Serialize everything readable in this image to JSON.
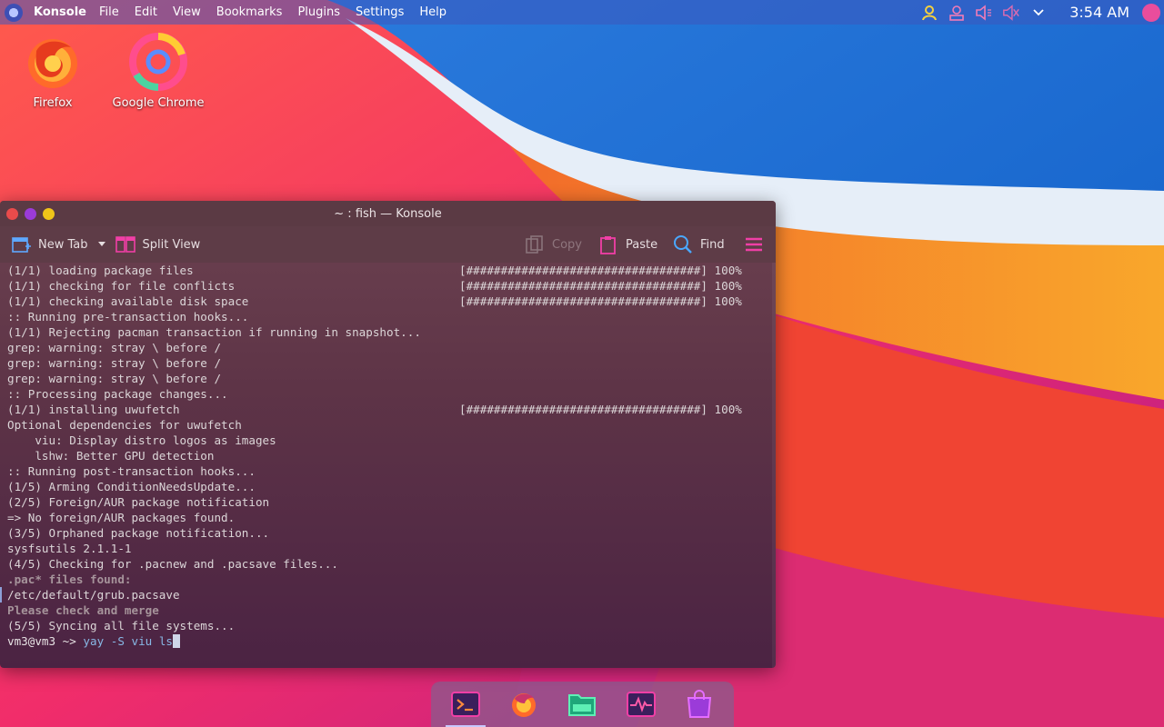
{
  "top_panel": {
    "app_name": "Konsole",
    "menu": [
      "File",
      "Edit",
      "View",
      "Bookmarks",
      "Plugins",
      "Settings",
      "Help"
    ],
    "clock": "3:54 AM",
    "tray_icons": [
      "user-icon",
      "account-icon",
      "volume-icon",
      "speaker-muted-icon",
      "chevron-down-icon"
    ]
  },
  "desktop": {
    "icons": [
      {
        "label": "Firefox",
        "icon": "firefox-icon"
      },
      {
        "label": "Google Chrome",
        "icon": "chrome-icon"
      }
    ]
  },
  "window": {
    "title": "~ : fish — Konsole",
    "toolbar": {
      "new_tab": "New Tab",
      "split_view": "Split View",
      "copy": "Copy",
      "paste": "Paste",
      "find": "Find"
    }
  },
  "terminal": {
    "lines": [
      {
        "text": "(1/1) loading package files",
        "progress": "[##################################] 100%"
      },
      {
        "text": "(1/1) checking for file conflicts",
        "progress": "[##################################] 100%"
      },
      {
        "text": "(1/1) checking available disk space",
        "progress": "[##################################] 100%"
      },
      {
        "text": ":: Running pre-transaction hooks..."
      },
      {
        "text": "(1/1) Rejecting pacman transaction if running in snapshot..."
      },
      {
        "text": "grep: warning: stray \\ before /"
      },
      {
        "text": "grep: warning: stray \\ before /"
      },
      {
        "text": "grep: warning: stray \\ before /"
      },
      {
        "text": ":: Processing package changes..."
      },
      {
        "text": "(1/1) installing uwufetch",
        "progress": "[##################################] 100%"
      },
      {
        "text": "Optional dependencies for uwufetch"
      },
      {
        "text": "    viu: Display distro logos as images"
      },
      {
        "text": "    lshw: Better GPU detection"
      },
      {
        "text": ":: Running post-transaction hooks..."
      },
      {
        "text": "(1/5) Arming ConditionNeedsUpdate..."
      },
      {
        "text": "(2/5) Foreign/AUR package notification"
      },
      {
        "text": "=> No foreign/AUR packages found."
      },
      {
        "text": "(3/5) Orphaned package notification..."
      },
      {
        "text": "sysfsutils 2.1.1-1"
      },
      {
        "text": "(4/5) Checking for .pacnew and .pacsave files..."
      },
      {
        "text": ".pac* files found:",
        "style": "dim"
      },
      {
        "text": "/etc/default/grub.pacsave",
        "style": "marker"
      },
      {
        "text": "Please check and merge",
        "style": "dim"
      },
      {
        "text": "(5/5) Syncing all file systems..."
      }
    ],
    "prompt": "vm3@vm3 ~>",
    "command": "yay -S viu ls"
  },
  "dock": {
    "items": [
      "terminal-icon",
      "firefox-icon",
      "files-icon",
      "system-monitor-icon",
      "store-icon"
    ]
  },
  "colors": {
    "panel": "#3c58be",
    "accent_pink": "#e94d9c",
    "close": "#e94b4b",
    "minimize": "#9b3bd9",
    "maximize": "#f0c419"
  }
}
